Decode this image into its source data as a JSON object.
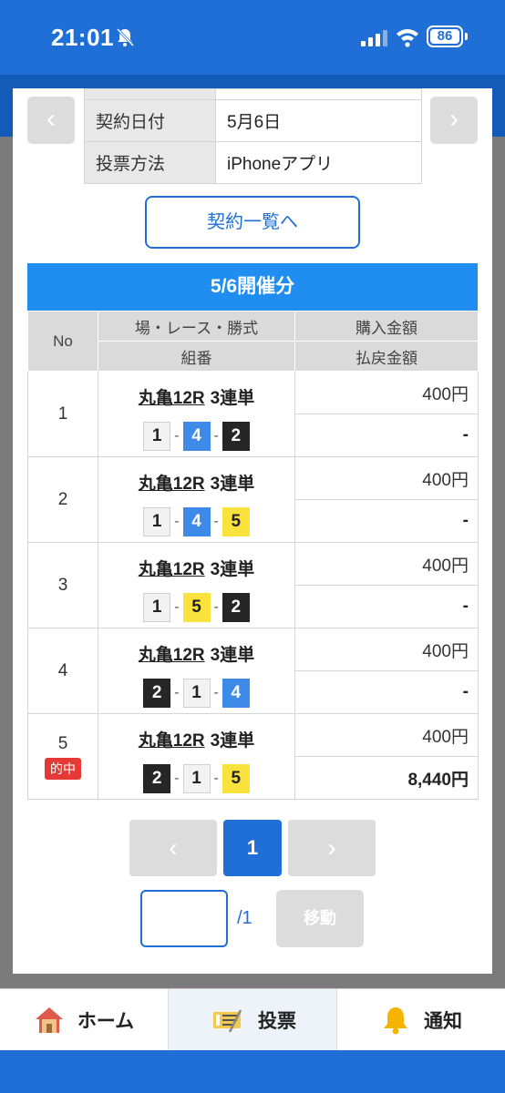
{
  "status": {
    "time": "21:01",
    "battery": "86"
  },
  "modal": {
    "prev_arrow": "‹",
    "next_arrow": "›",
    "info": [
      {
        "label": "契約日付",
        "value": "5月6日"
      },
      {
        "label": "投票方法",
        "value": "iPhoneアプリ"
      }
    ],
    "contract_list_button": "契約一覧へ",
    "section_title": "5/6開催分",
    "table": {
      "headers": {
        "no": "No",
        "race": "場・レース・勝式",
        "combo": "組番",
        "purchase": "購入金額",
        "payout": "払戻金額"
      },
      "rows": [
        {
          "no": "1",
          "venue": "丸亀12R",
          "type": "3連単",
          "combo": [
            "1",
            "4",
            "2"
          ],
          "purchase": "400円",
          "payout": "-",
          "hit": ""
        },
        {
          "no": "2",
          "venue": "丸亀12R",
          "type": "3連単",
          "combo": [
            "1",
            "4",
            "5"
          ],
          "purchase": "400円",
          "payout": "-",
          "hit": ""
        },
        {
          "no": "3",
          "venue": "丸亀12R",
          "type": "3連単",
          "combo": [
            "1",
            "5",
            "2"
          ],
          "purchase": "400円",
          "payout": "-",
          "hit": ""
        },
        {
          "no": "4",
          "venue": "丸亀12R",
          "type": "3連単",
          "combo": [
            "2",
            "1",
            "4"
          ],
          "purchase": "400円",
          "payout": "-",
          "hit": ""
        },
        {
          "no": "5",
          "venue": "丸亀12R",
          "type": "3連単",
          "combo": [
            "2",
            "1",
            "5"
          ],
          "purchase": "400円",
          "payout": "8,440円",
          "hit": "的中"
        }
      ],
      "combo_separator": "-"
    },
    "pagination": {
      "prev": "‹",
      "current": "1",
      "next": "›",
      "total": "/1",
      "input_value": "",
      "move_button": "移動"
    }
  },
  "bottom_nav": {
    "items": [
      {
        "label": "ホーム",
        "icon": "house-icon"
      },
      {
        "label": "投票",
        "icon": "ticket-icon"
      },
      {
        "label": "通知",
        "icon": "bell-icon"
      }
    ],
    "active_index": 1
  },
  "colors": {
    "brand_blue": "#1f6fd6",
    "section_blue": "#1f8ef0",
    "hit_red": "#e53935",
    "boat_1": "#f2f2f2",
    "boat_2": "#262626",
    "boat_4": "#3e8ae8",
    "boat_5": "#f9e23b"
  }
}
